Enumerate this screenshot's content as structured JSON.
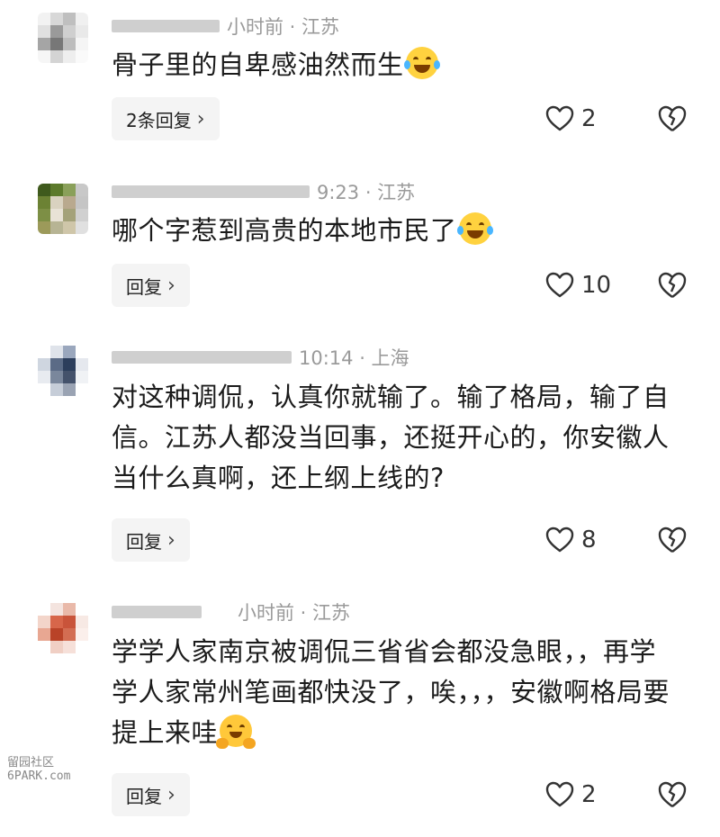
{
  "comments": [
    {
      "location": "小时前 · 江苏",
      "text": "骨子里的自卑感油然而生",
      "emoji": "grin-tears",
      "reply_label": "2条回复",
      "likes": "2"
    },
    {
      "location": "9:23 · 江苏",
      "text": "哪个字惹到高贵的本地市民了",
      "emoji": "grin-tears",
      "reply_label": "回复",
      "likes": "10"
    },
    {
      "location": "10:14 · 上海",
      "text": "对这种调侃，认真你就输了。输了格局，输了自信。江苏人都没当回事，还挺开心的，你安徽人当什么真啊，还上纲上线的?",
      "reply_label": "回复",
      "likes": "8"
    },
    {
      "location": "小时前 · 江苏",
      "text": "学学人家南京被调侃三省省会都没急眼，，再学学人家常州笔画都快没了，唉，，，安徽啊格局要提上来哇",
      "emoji": "hugging-face",
      "reply_label": "回复",
      "likes": "2"
    }
  ],
  "watermark": {
    "line1": "留园社区",
    "line2": "6PARK.com"
  },
  "colors": {
    "meta": "#9a9a9a",
    "reply_bg": "#f4f4f4",
    "icon": "#333333"
  }
}
